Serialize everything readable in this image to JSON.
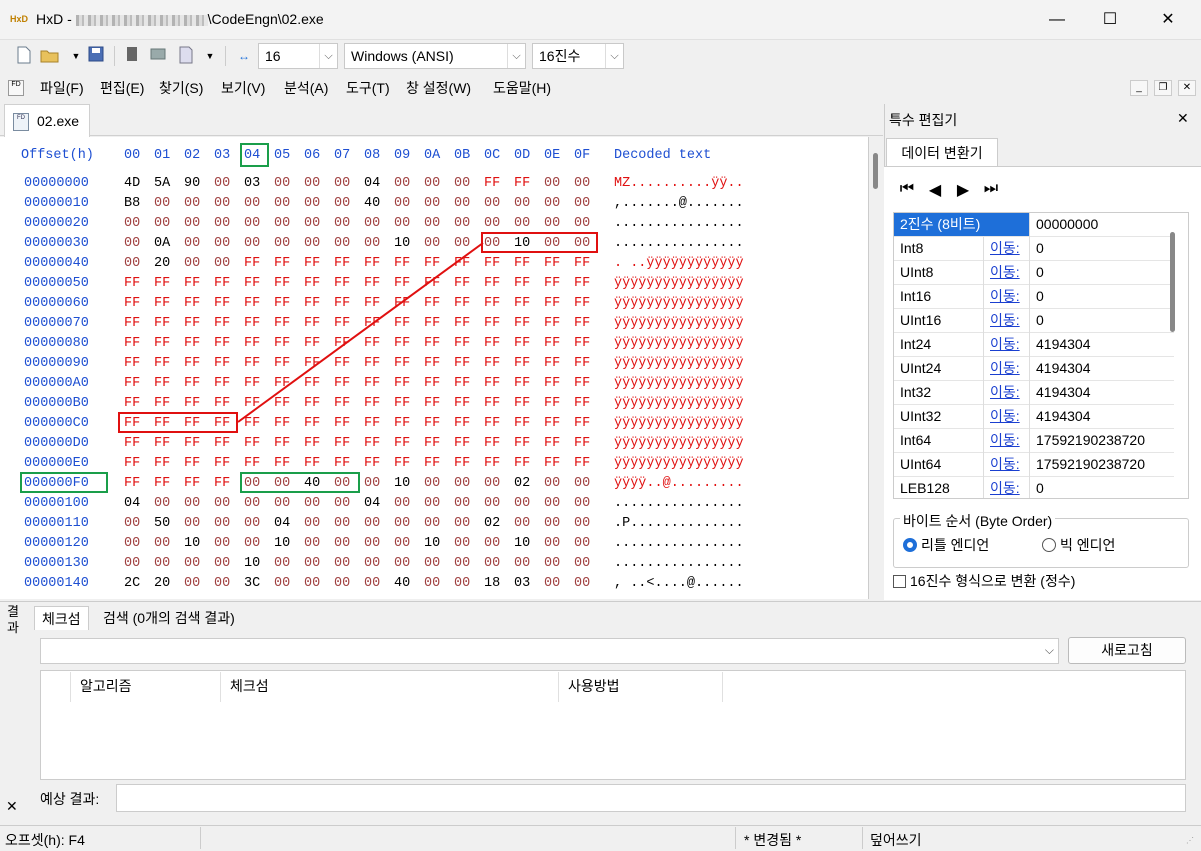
{
  "window": {
    "app": "HxD",
    "title_prefix": "HxD - ",
    "title_suffix": "\\CodeEngn\\02.exe",
    "minimize": "—",
    "maximize": "☐",
    "close": "✕"
  },
  "toolbar": {
    "bytes_per_row": "16",
    "encoding": "Windows (ANSI)",
    "base": "16진수"
  },
  "menu": [
    "파일(F)",
    "편집(E)",
    "찾기(S)",
    "보기(V)",
    "분석(A)",
    "도구(T)",
    "창 설정(W)",
    "도움말(H)"
  ],
  "tab": {
    "label": "02.exe",
    "icon_text": "FD"
  },
  "hex": {
    "header_offset": "Offset(h)",
    "header_cols": [
      "00",
      "01",
      "02",
      "03",
      "04",
      "05",
      "06",
      "07",
      "08",
      "09",
      "0A",
      "0B",
      "0C",
      "0D",
      "0E",
      "0F"
    ],
    "header_decoded": "Decoded text",
    "rows": [
      {
        "off": "00000000",
        "b": [
          "4D",
          "5A",
          "90",
          "00",
          "03",
          "00",
          "00",
          "00",
          "04",
          "00",
          "00",
          "00",
          "FF",
          "FF",
          "00",
          "00"
        ],
        "t": "MZ..........ÿÿ.."
      },
      {
        "off": "00000010",
        "b": [
          "B8",
          "00",
          "00",
          "00",
          "00",
          "00",
          "00",
          "00",
          "40",
          "00",
          "00",
          "00",
          "00",
          "00",
          "00",
          "00"
        ],
        "t": ",.......@......."
      },
      {
        "off": "00000020",
        "b": [
          "00",
          "00",
          "00",
          "00",
          "00",
          "00",
          "00",
          "00",
          "00",
          "00",
          "00",
          "00",
          "00",
          "00",
          "00",
          "00"
        ],
        "t": "................"
      },
      {
        "off": "00000030",
        "b": [
          "00",
          "0A",
          "00",
          "00",
          "00",
          "00",
          "00",
          "00",
          "00",
          "10",
          "00",
          "00",
          "00",
          "10",
          "00",
          "00"
        ],
        "t": "................"
      },
      {
        "off": "00000040",
        "b": [
          "00",
          "20",
          "00",
          "00",
          "FF",
          "FF",
          "FF",
          "FF",
          "FF",
          "FF",
          "FF",
          "FF",
          "FF",
          "FF",
          "FF",
          "FF"
        ],
        "t": ". ..ÿÿÿÿÿÿÿÿÿÿÿÿ"
      },
      {
        "off": "00000050",
        "b": [
          "FF",
          "FF",
          "FF",
          "FF",
          "FF",
          "FF",
          "FF",
          "FF",
          "FF",
          "FF",
          "FF",
          "FF",
          "FF",
          "FF",
          "FF",
          "FF"
        ],
        "t": "ÿÿÿÿÿÿÿÿÿÿÿÿÿÿÿÿ"
      },
      {
        "off": "00000060",
        "b": [
          "FF",
          "FF",
          "FF",
          "FF",
          "FF",
          "FF",
          "FF",
          "FF",
          "FF",
          "FF",
          "FF",
          "FF",
          "FF",
          "FF",
          "FF",
          "FF"
        ],
        "t": "ÿÿÿÿÿÿÿÿÿÿÿÿÿÿÿÿ"
      },
      {
        "off": "00000070",
        "b": [
          "FF",
          "FF",
          "FF",
          "FF",
          "FF",
          "FF",
          "FF",
          "FF",
          "FF",
          "FF",
          "FF",
          "FF",
          "FF",
          "FF",
          "FF",
          "FF"
        ],
        "t": "ÿÿÿÿÿÿÿÿÿÿÿÿÿÿÿÿ"
      },
      {
        "off": "00000080",
        "b": [
          "FF",
          "FF",
          "FF",
          "FF",
          "FF",
          "FF",
          "FF",
          "FF",
          "FF",
          "FF",
          "FF",
          "FF",
          "FF",
          "FF",
          "FF",
          "FF"
        ],
        "t": "ÿÿÿÿÿÿÿÿÿÿÿÿÿÿÿÿ"
      },
      {
        "off": "00000090",
        "b": [
          "FF",
          "FF",
          "FF",
          "FF",
          "FF",
          "FF",
          "FF",
          "FF",
          "FF",
          "FF",
          "FF",
          "FF",
          "FF",
          "FF",
          "FF",
          "FF"
        ],
        "t": "ÿÿÿÿÿÿÿÿÿÿÿÿÿÿÿÿ"
      },
      {
        "off": "000000A0",
        "b": [
          "FF",
          "FF",
          "FF",
          "FF",
          "FF",
          "FF",
          "FF",
          "FF",
          "FF",
          "FF",
          "FF",
          "FF",
          "FF",
          "FF",
          "FF",
          "FF"
        ],
        "t": "ÿÿÿÿÿÿÿÿÿÿÿÿÿÿÿÿ"
      },
      {
        "off": "000000B0",
        "b": [
          "FF",
          "FF",
          "FF",
          "FF",
          "FF",
          "FF",
          "FF",
          "FF",
          "FF",
          "FF",
          "FF",
          "FF",
          "FF",
          "FF",
          "FF",
          "FF"
        ],
        "t": "ÿÿÿÿÿÿÿÿÿÿÿÿÿÿÿÿ"
      },
      {
        "off": "000000C0",
        "b": [
          "FF",
          "FF",
          "FF",
          "FF",
          "FF",
          "FF",
          "FF",
          "FF",
          "FF",
          "FF",
          "FF",
          "FF",
          "FF",
          "FF",
          "FF",
          "FF"
        ],
        "t": "ÿÿÿÿÿÿÿÿÿÿÿÿÿÿÿÿ"
      },
      {
        "off": "000000D0",
        "b": [
          "FF",
          "FF",
          "FF",
          "FF",
          "FF",
          "FF",
          "FF",
          "FF",
          "FF",
          "FF",
          "FF",
          "FF",
          "FF",
          "FF",
          "FF",
          "FF"
        ],
        "t": "ÿÿÿÿÿÿÿÿÿÿÿÿÿÿÿÿ"
      },
      {
        "off": "000000E0",
        "b": [
          "FF",
          "FF",
          "FF",
          "FF",
          "FF",
          "FF",
          "FF",
          "FF",
          "FF",
          "FF",
          "FF",
          "FF",
          "FF",
          "FF",
          "FF",
          "FF"
        ],
        "t": "ÿÿÿÿÿÿÿÿÿÿÿÿÿÿÿÿ"
      },
      {
        "off": "000000F0",
        "b": [
          "FF",
          "FF",
          "FF",
          "FF",
          "00",
          "00",
          "40",
          "00",
          "00",
          "10",
          "00",
          "00",
          "00",
          "02",
          "00",
          "00"
        ],
        "t": "ÿÿÿÿ..@........."
      },
      {
        "off": "00000100",
        "b": [
          "04",
          "00",
          "00",
          "00",
          "00",
          "00",
          "00",
          "00",
          "04",
          "00",
          "00",
          "00",
          "00",
          "00",
          "00",
          "00"
        ],
        "t": "................"
      },
      {
        "off": "00000110",
        "b": [
          "00",
          "50",
          "00",
          "00",
          "00",
          "04",
          "00",
          "00",
          "00",
          "00",
          "00",
          "00",
          "02",
          "00",
          "00",
          "00"
        ],
        "t": ".P.............."
      },
      {
        "off": "00000120",
        "b": [
          "00",
          "00",
          "10",
          "00",
          "00",
          "10",
          "00",
          "00",
          "00",
          "00",
          "10",
          "00",
          "00",
          "10",
          "00",
          "00"
        ],
        "t": "................"
      },
      {
        "off": "00000130",
        "b": [
          "00",
          "00",
          "00",
          "00",
          "10",
          "00",
          "00",
          "00",
          "00",
          "00",
          "00",
          "00",
          "00",
          "00",
          "00",
          "00"
        ],
        "t": "................"
      },
      {
        "off": "00000140",
        "b": [
          "2C",
          "20",
          "00",
          "00",
          "3C",
          "00",
          "00",
          "00",
          "00",
          "40",
          "00",
          "00",
          "18",
          "03",
          "00",
          "00"
        ],
        "t": ", ..<....@......"
      }
    ]
  },
  "right_panel": {
    "title": "특수 편집기",
    "close": "✕",
    "tab": "데이터 변환기",
    "nav": [
      "⏮",
      "◀",
      "▶",
      "⏭"
    ],
    "link": "이동:",
    "rows": [
      {
        "name": "2진수 (8비트)",
        "value": "00000000",
        "link": false
      },
      {
        "name": "Int8",
        "value": "0",
        "link": true
      },
      {
        "name": "UInt8",
        "value": "0",
        "link": true
      },
      {
        "name": "Int16",
        "value": "0",
        "link": true
      },
      {
        "name": "UInt16",
        "value": "0",
        "link": true
      },
      {
        "name": "Int24",
        "value": "4194304",
        "link": true
      },
      {
        "name": "UInt24",
        "value": "4194304",
        "link": true
      },
      {
        "name": "Int32",
        "value": "4194304",
        "link": true
      },
      {
        "name": "UInt32",
        "value": "4194304",
        "link": true
      },
      {
        "name": "Int64",
        "value": "17592190238720",
        "link": true
      },
      {
        "name": "UInt64",
        "value": "17592190238720",
        "link": true
      },
      {
        "name": "LEB128",
        "value": "0",
        "link": true
      }
    ],
    "byte_order_label": "바이트 순서 (Byte Order)",
    "little": "리틀 엔디언",
    "big": "빅 엔디언",
    "hex_checkbox": "16진수 형식으로 변환 (정수)"
  },
  "bottom": {
    "side_label": "결과",
    "close": "✕",
    "tab_checksum": "체크섬",
    "tab_search": "검색 (0개의 검색 결과)",
    "refresh": "새로고침",
    "cols": [
      "알고리즘",
      "체크섬",
      "사용방법"
    ],
    "expected_label": "예상 결과:"
  },
  "status": {
    "offset": "오프셋(h): F4",
    "changed": "* 변경됨 *",
    "mode": "덮어쓰기"
  },
  "colors": {
    "accent": "#1e6fd9",
    "highlight_green": "#1a9e4a",
    "highlight_red": "#e01010",
    "hex_blue": "#1e4fd2"
  }
}
